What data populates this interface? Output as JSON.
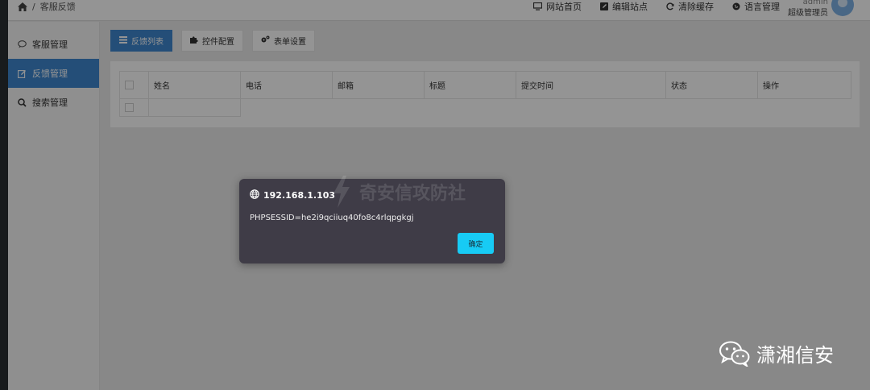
{
  "breadcrumb": {
    "separator": "/",
    "current": "客服反馈"
  },
  "topnav": {
    "links": [
      {
        "label": "网站首页",
        "icon": "monitor-icon"
      },
      {
        "label": "编辑站点",
        "icon": "edit-icon"
      },
      {
        "label": "清除缓存",
        "icon": "refresh-icon"
      },
      {
        "label": "语言管理",
        "icon": "globe-icon"
      }
    ],
    "user_name": "admin",
    "user_role": "超级管理员"
  },
  "sidebar": {
    "items": [
      {
        "label": "客服管理",
        "icon": "comment-icon",
        "active": false
      },
      {
        "label": "反馈管理",
        "icon": "edit-icon",
        "active": true
      },
      {
        "label": "搜索管理",
        "icon": "search-icon",
        "active": false
      }
    ]
  },
  "toolbar": {
    "list_label": "反馈列表",
    "controls_label": "控件配置",
    "form_label": "表单设置"
  },
  "table": {
    "columns": [
      "姓名",
      "电话",
      "邮箱",
      "标题",
      "提交时间",
      "状态",
      "操作"
    ]
  },
  "dialog": {
    "host": "192.168.1.103",
    "message": "PHPSESSID=he2i9qciiuq40fo8c4rlqpgkgj",
    "ok_label": "确定",
    "watermark": "奇安信攻防社"
  },
  "brand": {
    "label": "潇湘信安"
  },
  "colors": {
    "accent": "#3f87cf",
    "ok_button": "#17cbf5",
    "dialog_bg": "#3f3c47"
  }
}
